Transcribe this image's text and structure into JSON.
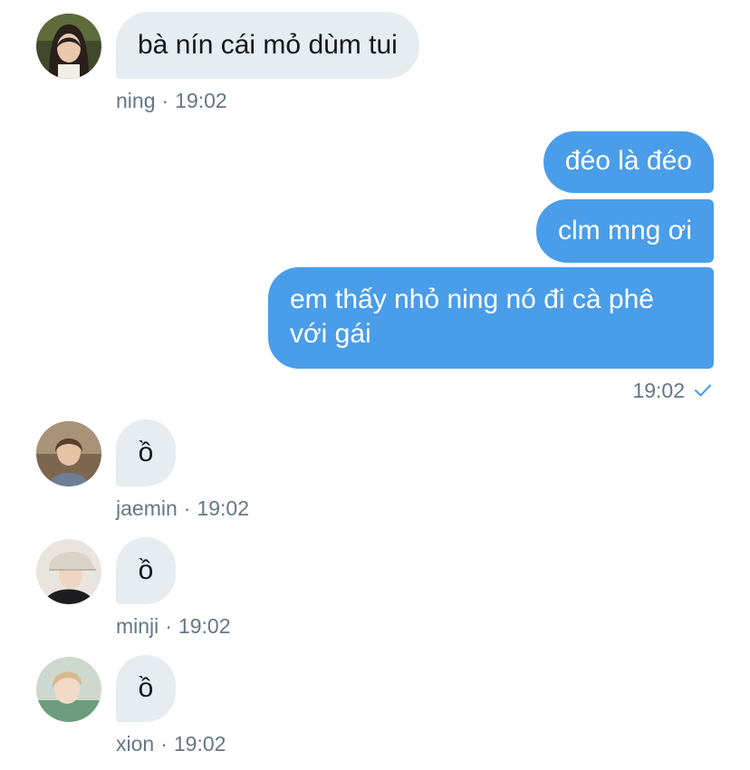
{
  "conversation": {
    "messages": [
      {
        "sender": "ning",
        "text": "bà nín cái mỏ dùm tui",
        "time": "19:02",
        "avatar_icon": "ning-avatar-icon"
      },
      {
        "sender": "me",
        "text": "đéo là đéo"
      },
      {
        "sender": "me",
        "text": "clm mng ơi"
      },
      {
        "sender": "me",
        "text": "em thấy nhỏ ning nó đi cà phê với gái"
      },
      {
        "sender": "jaemin",
        "text": "ồ",
        "time": "19:02",
        "avatar_icon": "jaemin-avatar-icon"
      },
      {
        "sender": "minji",
        "text": "ồ",
        "time": "19:02",
        "avatar_icon": "minji-avatar-icon"
      },
      {
        "sender": "xion",
        "text": "ồ",
        "time": "19:02",
        "avatar_icon": "xion-avatar-icon"
      }
    ],
    "sent_group": {
      "time": "19:02",
      "status_icon": "check-icon"
    }
  },
  "colors": {
    "outgoing_bubble": "#4a9de9",
    "incoming_bubble": "#e6ecf0",
    "meta_text": "#657786",
    "incoming_text": "#14171a"
  }
}
